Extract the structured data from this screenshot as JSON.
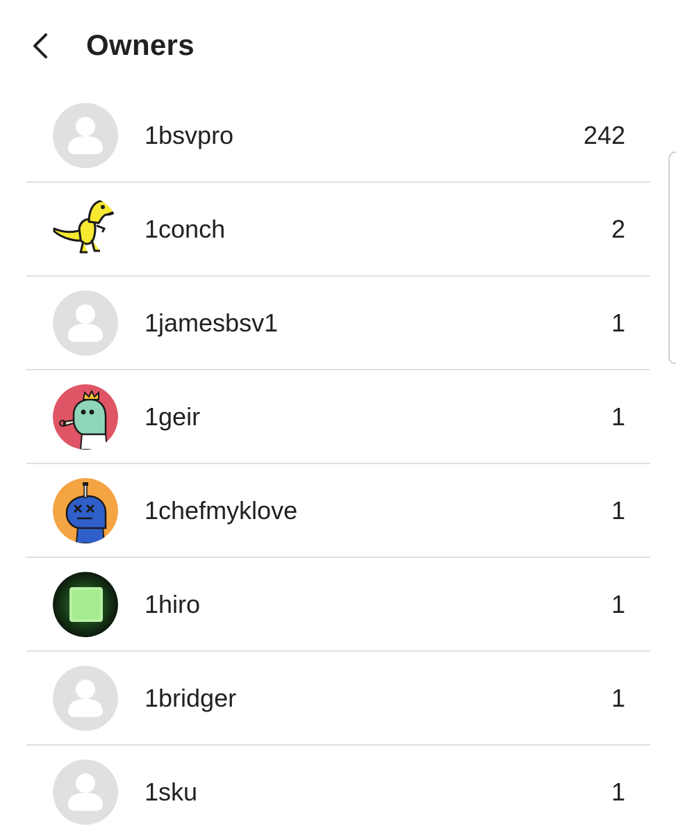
{
  "header": {
    "back_icon": "chevron-left-icon",
    "title": "Owners"
  },
  "owners": [
    {
      "name": "1bsvpro",
      "count": "242",
      "avatar": "default-avatar-icon"
    },
    {
      "name": "1conch",
      "count": "2",
      "avatar": "yellow-dinosaur-avatar"
    },
    {
      "name": "1jamesbsv1",
      "count": "1",
      "avatar": "default-avatar-icon"
    },
    {
      "name": "1geir",
      "count": "1",
      "avatar": "crowned-dinosaur-avatar"
    },
    {
      "name": "1chefmyklove",
      "count": "1",
      "avatar": "blue-dinosaur-avatar"
    },
    {
      "name": "1hiro",
      "count": "1",
      "avatar": "glowing-cube-avatar"
    },
    {
      "name": "1bridger",
      "count": "1",
      "avatar": "default-avatar-icon"
    },
    {
      "name": "1sku",
      "count": "1",
      "avatar": "default-avatar-icon"
    }
  ],
  "colors": {
    "text": "#212121",
    "divider": "#e0e0e0",
    "default_avatar_bg": "#e0e0e0",
    "default_avatar_fg": "#ffffff",
    "geir_avatar_bg": "#e05565",
    "chefmyklove_avatar_bg": "#f5a443",
    "hiro_avatar_bg": "#0d1a0d",
    "conch_dino": "#f7e931"
  }
}
